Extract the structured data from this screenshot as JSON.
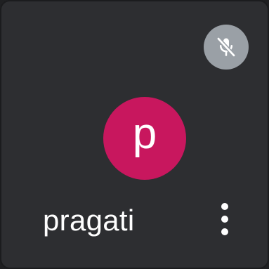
{
  "participant": {
    "name": "pragati",
    "avatar_initial": "p",
    "avatar_color": "#c8175e"
  },
  "status": {
    "microphone": "muted",
    "mic_icon": "mic-off-icon"
  },
  "controls": {
    "more_icon": "more-vert-icon"
  },
  "colors": {
    "tile_background": "#2d2e31",
    "mic_button_background": "#9aa0a6",
    "text": "#ffffff"
  }
}
